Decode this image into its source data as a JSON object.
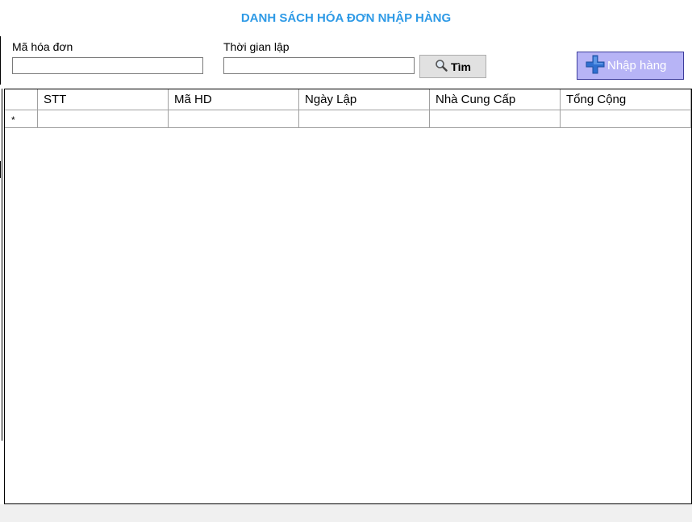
{
  "title": "DANH SÁCH HÓA ĐƠN NHẬP HÀNG",
  "filters": {
    "invoice_id_label": "Mã hóa đơn",
    "invoice_id_value": "",
    "created_time_label": "Thời gian lập",
    "created_time_value": ""
  },
  "buttons": {
    "search_label": "Tìm",
    "search_icon": "magnifier-icon",
    "import_label": "Nhập hàng",
    "import_icon": "plus-icon"
  },
  "grid": {
    "columns": [
      "STT",
      "Mã HD",
      "Ngày Lập",
      "Nhà Cung Cấp",
      "Tổng Cộng"
    ],
    "new_row_marker": "*",
    "rows": []
  },
  "colors": {
    "title": "#2e9ae6",
    "import_button_bg": "#b7b4f6",
    "search_button_bg": "#e1e1e1",
    "plus_icon": "#2f6fd0"
  }
}
